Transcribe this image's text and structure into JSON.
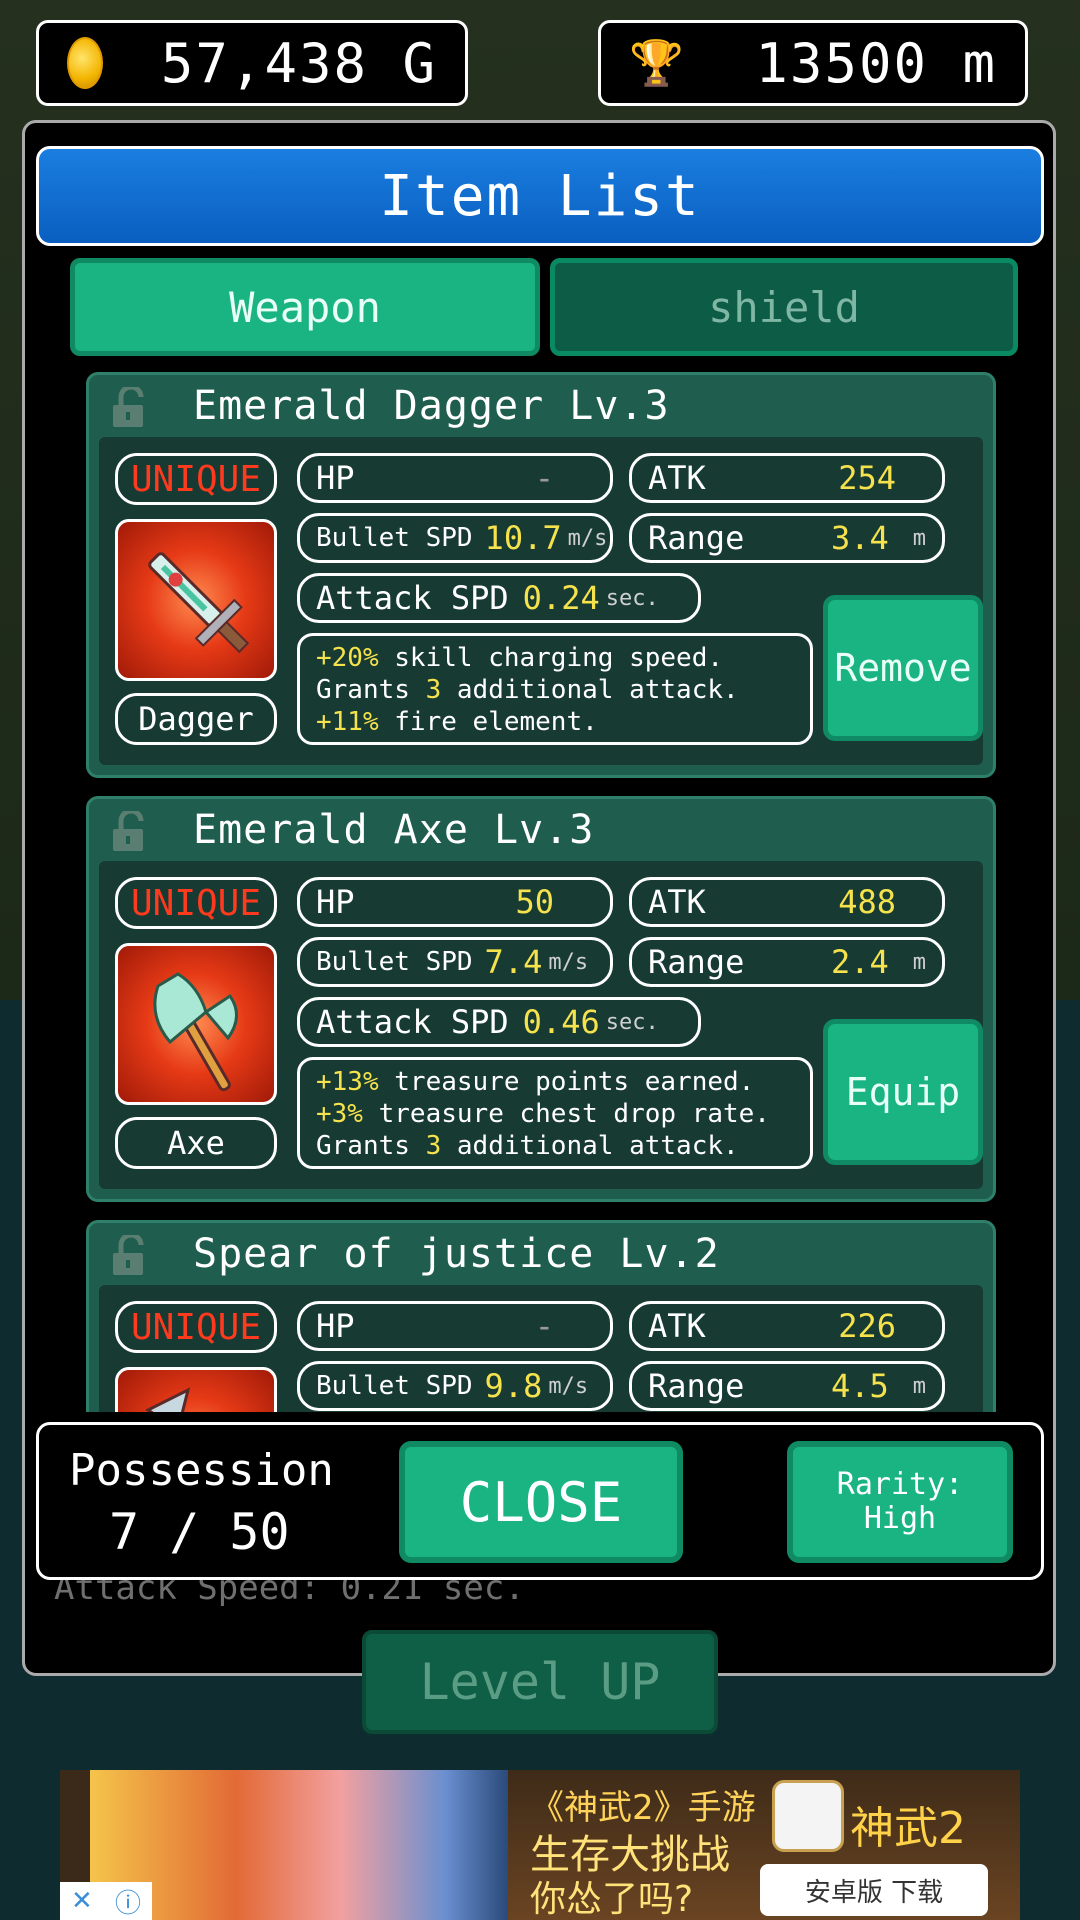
{
  "hud": {
    "gold": "57,438 G",
    "distance": "13500 m"
  },
  "back_panel": {
    "faint_label": "Attack Speed: 0.21 sec.",
    "level_up": "Level UP"
  },
  "dialog": {
    "title": "Item List",
    "tabs": [
      {
        "label": "Weapon",
        "active": true
      },
      {
        "label": "shield",
        "active": false
      }
    ],
    "items": [
      {
        "name": "Emerald Dagger Lv.3",
        "rarity": "UNIQUE",
        "type": "Dagger",
        "hp_label": "HP",
        "hp": "-",
        "atk_label": "ATK",
        "atk": "254",
        "bullet_label": "Bullet SPD",
        "bullet_spd": "10.7",
        "bullet_unit": "m/s",
        "range_label": "Range",
        "range": "3.4",
        "range_unit": "m",
        "aspd_label": "Attack SPD",
        "attack_spd": "0.24",
        "aspd_unit": "sec.",
        "effects": [
          {
            "value": "+20%",
            "text": " skill charging speed."
          },
          {
            "pre": "Grants ",
            "value": "3",
            "text": " additional attack."
          },
          {
            "value": "+11%",
            "text": " fire element."
          }
        ],
        "action": "Remove"
      },
      {
        "name": "Emerald Axe Lv.3",
        "rarity": "UNIQUE",
        "type": "Axe",
        "hp_label": "HP",
        "hp": "50",
        "atk_label": "ATK",
        "atk": "488",
        "bullet_label": "Bullet SPD",
        "bullet_spd": "7.4",
        "bullet_unit": "m/s",
        "range_label": "Range",
        "range": "2.4",
        "range_unit": "m",
        "aspd_label": "Attack SPD",
        "attack_spd": "0.46",
        "aspd_unit": "sec.",
        "effects": [
          {
            "value": "+13%",
            "text": " treasure points earned."
          },
          {
            "value": "+3%",
            "text": " treasure chest drop rate."
          },
          {
            "pre": "Grants ",
            "value": "3",
            "text": " additional attack."
          }
        ],
        "action": "Equip"
      },
      {
        "name": "Spear of justice Lv.2",
        "rarity": "UNIQUE",
        "hp_label": "HP",
        "hp": "-",
        "atk_label": "ATK",
        "atk": "226",
        "bullet_label": "Bullet SPD",
        "bullet_spd": "9.8",
        "bullet_unit": "m/s",
        "range_label": "Range",
        "range": "4.5",
        "range_unit": "m"
      }
    ],
    "possession_label": "Possession",
    "possession_count": "7 / 50",
    "close": "CLOSE",
    "rarity_line1": "Rarity:",
    "rarity_line2": "High"
  },
  "ad": {
    "line1": "《神武2》手游",
    "line2": "生存大挑战",
    "line3": "你怂了吗?",
    "brand": "神武2",
    "download": "安卓版 下载"
  },
  "colors": {
    "accent_green": "#1ab482",
    "title_blue": "#0a6fd8",
    "highlight_yellow": "#f5e24c",
    "unique_red": "#ff3a1e"
  }
}
